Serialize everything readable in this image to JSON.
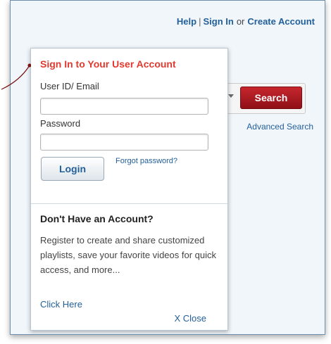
{
  "header": {
    "help_label": "Help",
    "separator": "|",
    "signin_label": "Sign In",
    "or_text": "or",
    "create_account_label": "Create Account"
  },
  "search": {
    "button_label": "Search",
    "advanced_label": "Advanced Search"
  },
  "popup": {
    "title": "Sign In to Your User Account",
    "userid_label": "User ID/ Email",
    "userid_value": "",
    "password_label": "Password",
    "password_value": "",
    "login_label": "Login",
    "forgot_label": "Forgot password?",
    "no_account_heading": "Don't Have an Account?",
    "register_text": "Register to create and share customized playlists, save your favorite videos for quick access, and more...",
    "click_here_label": "Click Here",
    "close_label": "X Close"
  },
  "colors": {
    "title_red": "#e03a2e",
    "link_blue": "#23609a",
    "search_red": "#b31d24"
  }
}
